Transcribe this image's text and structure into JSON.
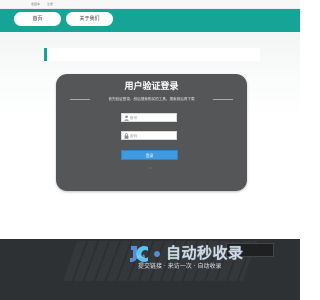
{
  "topbar": {
    "link1": "收藏本",
    "link2": "注册"
  },
  "nav": {
    "home_label": "首页",
    "about_label": "关于我们"
  },
  "login": {
    "title": "用户验证登录",
    "subtitle": "首先验证登录，然后搜索购买的工具。搜索到后再下载",
    "username_placeholder": "账号",
    "password_placeholder": "密码",
    "submit_label": "登录"
  },
  "watermark": {
    "name": "自动秒收录",
    "tagline": "提交链接 · 来访一次 · 自动收录",
    "small": "Jsub"
  },
  "colors": {
    "accent": "#15a496",
    "card": "#555658",
    "button": "#3f9ae0",
    "banner": "#2e3133"
  },
  "icons": {
    "user": "user-icon",
    "lock": "lock-icon"
  }
}
